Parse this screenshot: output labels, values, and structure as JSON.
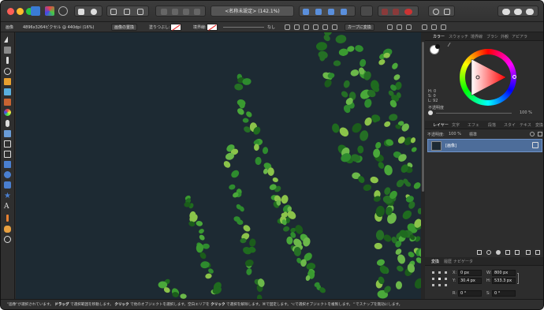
{
  "toolbar": {
    "document_title": "<名称未設定> (142.1%)"
  },
  "context": {
    "image_label": "画像",
    "image_info": "4896x3264ピクセル @ 440dpi (16%)",
    "replace_image_button": "画像の置換",
    "fill_label": "塗りつぶし:",
    "stroke_label": "境界線:",
    "stroke_value": "なし",
    "curve_convert_button": "カーブに変換"
  },
  "panels": {
    "color_tabs": [
      "カラー",
      "スウォッチ",
      "境界線",
      "ブラシ",
      "外観",
      "アピアラ"
    ],
    "hsl": [
      "H: 0",
      "S: 0",
      "L: 92"
    ],
    "opacity_label": "不透明度",
    "opacity_value": "100 %",
    "layer_tabs": [
      "レイヤー",
      "文字",
      "エフェ",
      "段落",
      "スタイ",
      "テキス",
      "変換"
    ],
    "layer_opacity_label": "不透明度:",
    "layer_opacity_value": "100 %",
    "blend_mode": "標準",
    "layer_name": "[画像]",
    "transform_tabs": [
      "変換",
      "履歴",
      "ナビゲータ"
    ],
    "transform": {
      "x_label": "X:",
      "x_value": "0 px",
      "y_label": "Y:",
      "y_value": "30.4 px",
      "w_label": "W:",
      "w_value": "800 px",
      "h_label": "H:",
      "h_value": "533.3 px",
      "r_label": "R:",
      "r_value": "0 °",
      "s_label": "S:",
      "s_value": "0 °"
    }
  },
  "status": {
    "p1": "\"画像\"が選択されています。",
    "b1": "ドラッグ",
    "p2": "で選択範囲を移動します。",
    "b2": "クリック",
    "p3": "で他のオブジェクトを選択します。空白エリアを",
    "b3": "クリック",
    "p4": "で選択を解除します。⌘で固定します。⌥で選択オブジェクトを複製します。⌃でスナップを無効にします。"
  },
  "colors": {
    "canvas_bg": "#1d2a33",
    "accent_blue": "#4d6d9a",
    "leaf_green": "#2e8b2e"
  }
}
